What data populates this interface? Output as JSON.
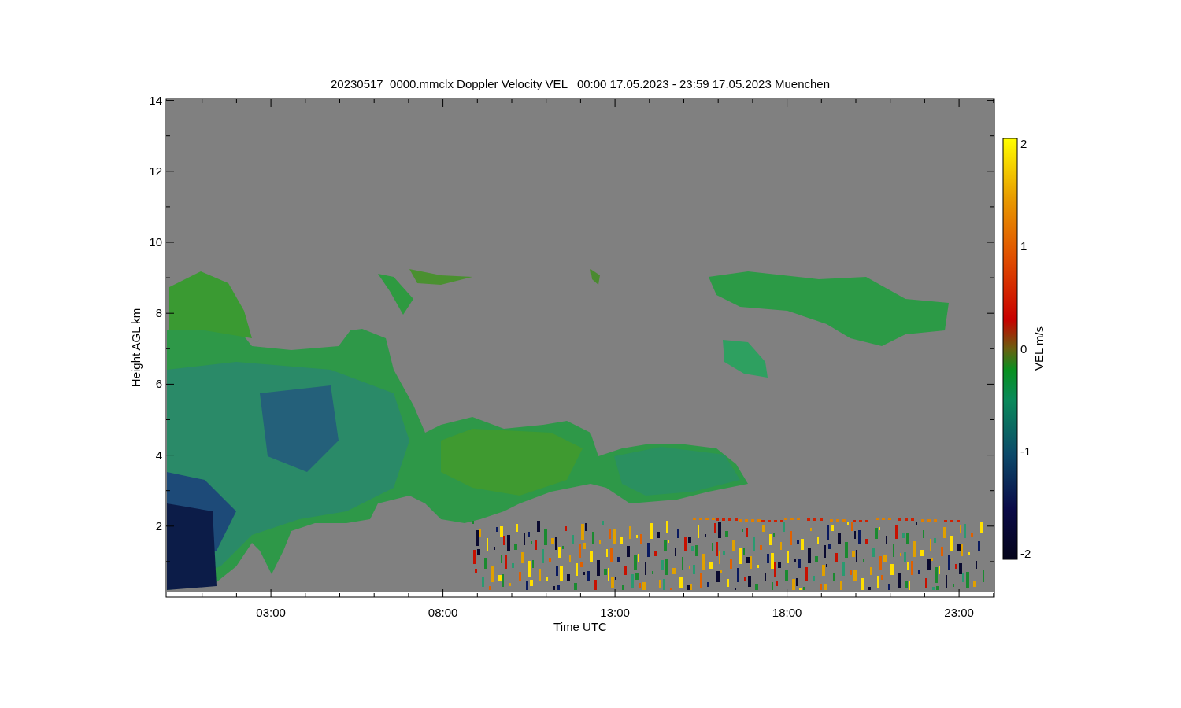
{
  "title": "20230517_0000.mmclx Doppler Velocity VEL   00:00 17.05.2023 - 23:59 17.05.2023 Muenchen",
  "y_axis": {
    "label": "Height AGL km",
    "ticks": [
      "14",
      "12",
      "10",
      "8",
      "6",
      "4",
      "2"
    ]
  },
  "x_axis": {
    "label": "Time UTC",
    "ticks": [
      "03:00",
      "08:00",
      "13:00",
      "18:00",
      "23:00"
    ]
  },
  "colorbar": {
    "label": "VEL m/s",
    "ticks": [
      "2",
      "1",
      "0",
      "-1",
      "-2"
    ]
  }
}
